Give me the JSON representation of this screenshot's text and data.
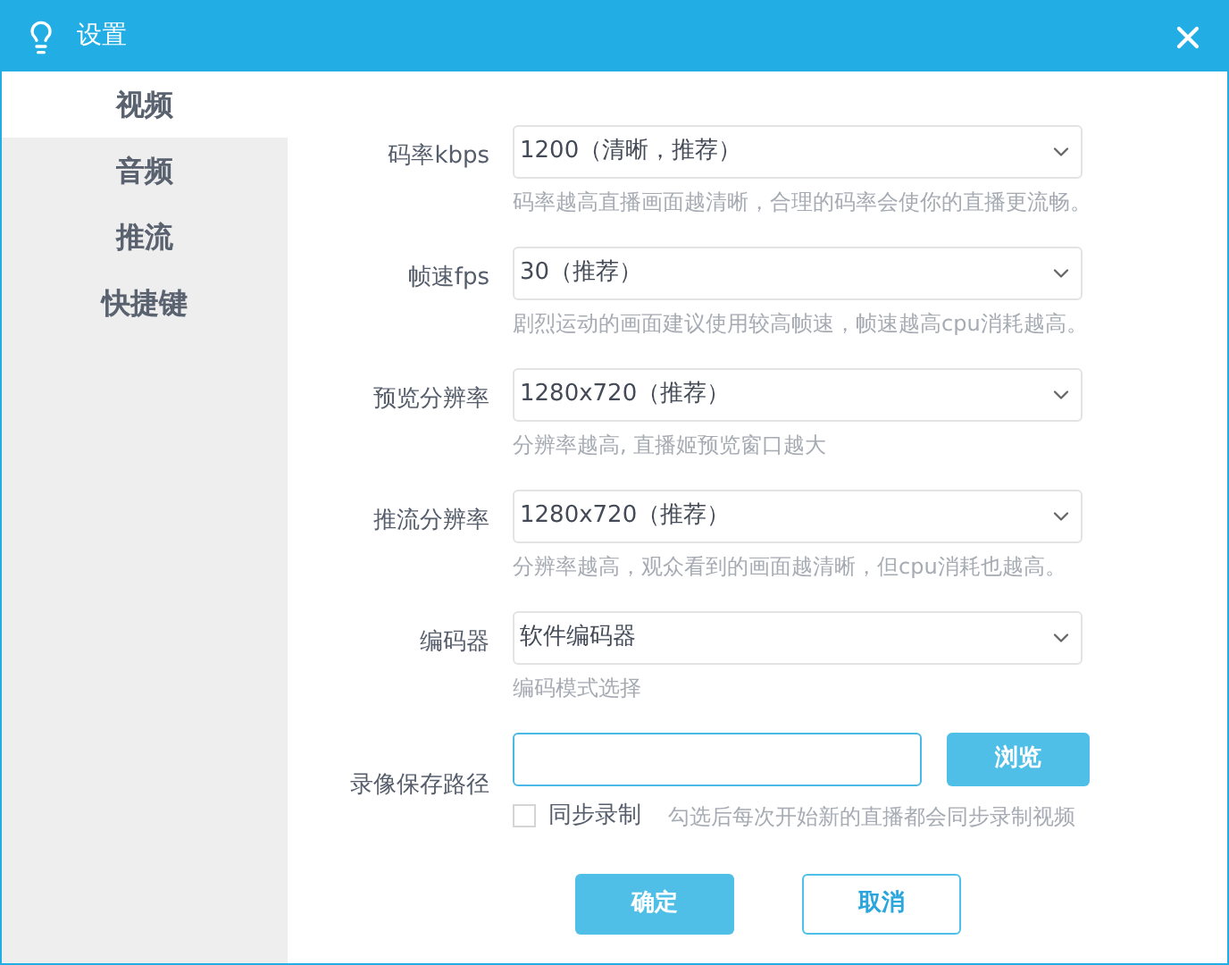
{
  "window": {
    "title": "设置"
  },
  "sidebar": {
    "items": [
      {
        "label": "视频",
        "selected": true
      },
      {
        "label": "音频",
        "selected": false
      },
      {
        "label": "推流",
        "selected": false
      },
      {
        "label": "快捷键",
        "selected": false
      }
    ]
  },
  "settings": [
    {
      "kind": "select",
      "label": "码率kbps",
      "value": "1200（清晰，推荐）",
      "hint": "码率越高直播画面越清晰，合理的码率会使你的直播更流畅。"
    },
    {
      "kind": "select",
      "label": "帧速fps",
      "value": "30（推荐）",
      "hint": "剧烈运动的画面建议使用较高帧速，帧速越高cpu消耗越高。"
    },
    {
      "kind": "select",
      "label": "预览分辨率",
      "value": "1280x720（推荐）",
      "hint": "分辨率越高, 直播姬预览窗口越大"
    },
    {
      "kind": "select",
      "label": "推流分辨率",
      "value": "1280x720（推荐）",
      "hint": "分辨率越高，观众看到的画面越清晰，但cpu消耗也越高。"
    },
    {
      "kind": "select",
      "label": "编码器",
      "value": "软件编码器",
      "hint": "编码模式选择"
    },
    {
      "kind": "path",
      "label": "录像保存路径",
      "button": "浏览",
      "checkbox": {
        "label": "同步录制",
        "checked": false
      },
      "hint": "勾选后每次开始新的直播都会同步录制视频"
    }
  ],
  "buttons": [
    {
      "label": "确定",
      "kind": "primary"
    },
    {
      "label": "取消",
      "kind": "secondary"
    }
  ]
}
